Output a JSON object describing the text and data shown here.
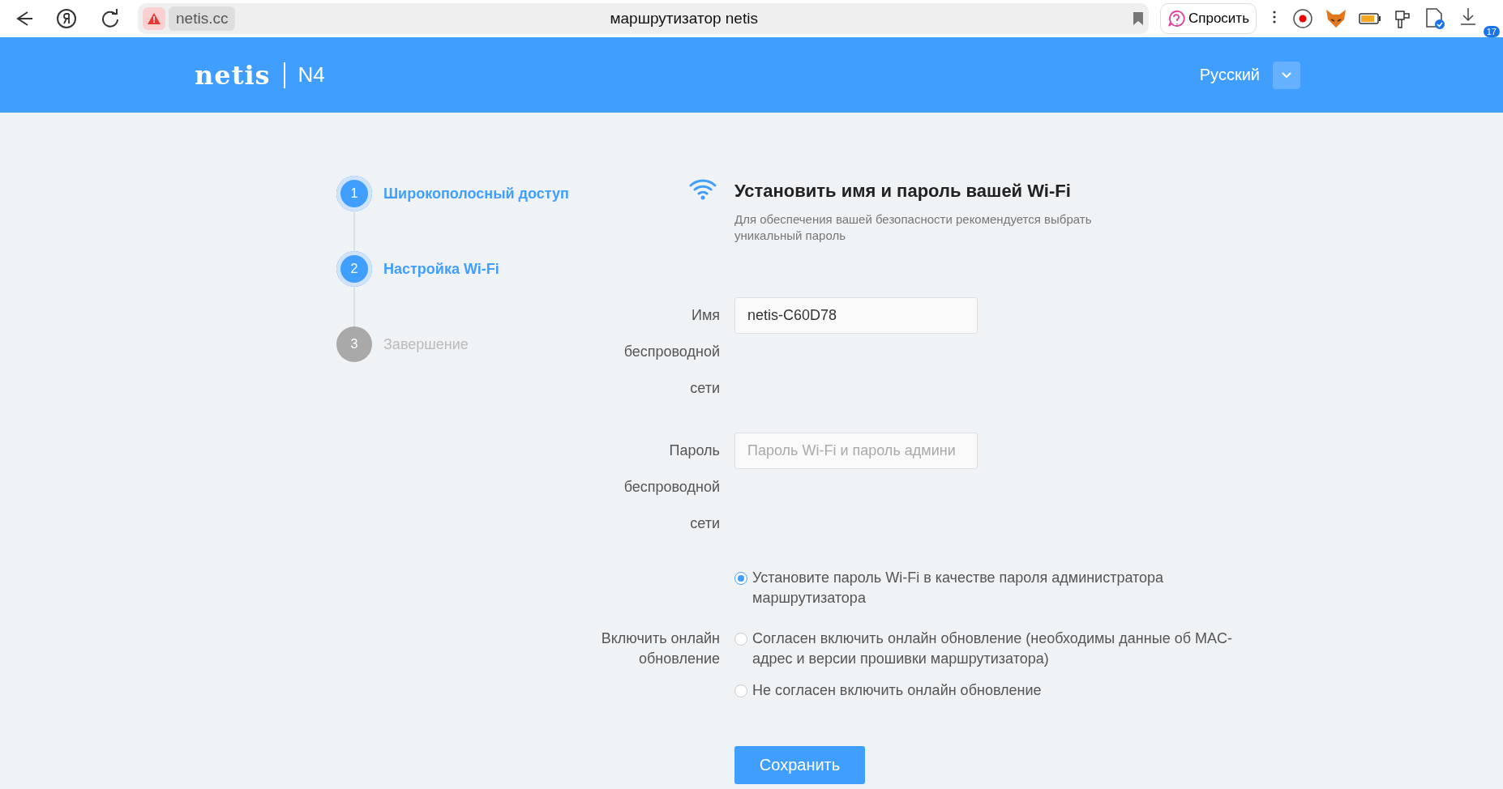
{
  "browser": {
    "address": "netis.cc",
    "page_title": "маршрутизатор netis",
    "ask_button": "Спросить",
    "downloads_badge": "17"
  },
  "header": {
    "logo": "netis",
    "model": "N4",
    "language": "Русский"
  },
  "steps": [
    {
      "number": "1",
      "label": "Широкополосный доступ",
      "done": true
    },
    {
      "number": "2",
      "label": "Настройка Wi-Fi",
      "done": true
    },
    {
      "number": "3",
      "label": "Завершение",
      "done": false
    }
  ],
  "section": {
    "title": "Установить имя и пароль вашей Wi-Fi",
    "subtitle": "Для обеспечения вашей безопасности рекомендуется выбрать уникальный пароль"
  },
  "fields": [
    {
      "label": "Имя беспроводной сети",
      "value": "netis-C60D78"
    },
    {
      "label": "Пароль беспроводной сети",
      "placeholder": "Пароль Wi-Fi и пароль админи"
    }
  ],
  "admin_password_option": {
    "label": "Установите пароль Wi-Fi в качестве пароля администратора маршрутизатора",
    "checked": true
  },
  "online_update": {
    "label": "Включить онлайн обновление",
    "options": [
      {
        "label": "Согласен включить онлайн обновление (необходимы данные об MAC-адрес и версии прошивки маршрутизатора)",
        "selected": false
      },
      {
        "label": "Не согласен включить онлайн обновление",
        "selected": false
      }
    ]
  },
  "save_button": "Сохранить"
}
